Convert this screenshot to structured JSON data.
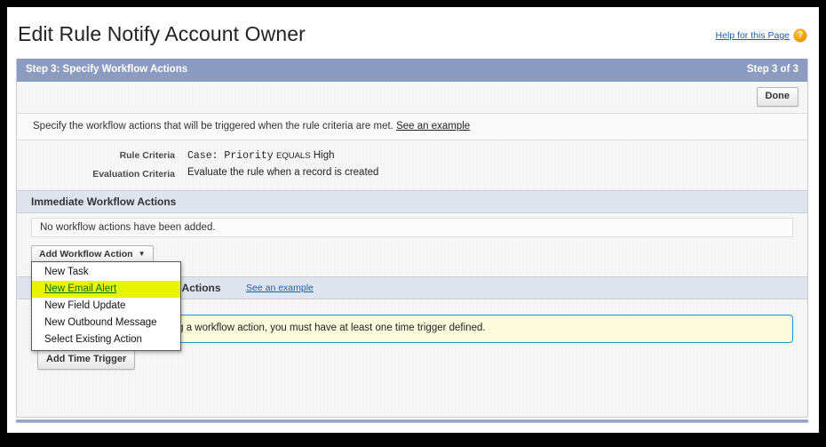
{
  "page": {
    "title": "Edit Rule Notify Account Owner",
    "help_link": "Help for this Page",
    "help_icon": "question-mark-icon",
    "help_icon_glyph": "?"
  },
  "step_bar": {
    "left_label": "Step 3: Specify Workflow Actions",
    "right_label": "Step 3 of 3",
    "background_color": "#8c9cc0"
  },
  "toolbar": {
    "done_label": "Done"
  },
  "instruction": {
    "text": "Specify the workflow actions that will be triggered when the rule criteria are met.",
    "link": "See an example"
  },
  "criteria": [
    {
      "label": "Rule Criteria",
      "object": "Case:",
      "field": "Priority",
      "operator": "EQUALS",
      "value": "High"
    },
    {
      "label": "Evaluation Criteria",
      "value": "Evaluate the rule when a record is created"
    }
  ],
  "immediate_section": {
    "title": "Immediate Workflow Actions",
    "empty_message": "No workflow actions have been added.",
    "add_button_label": "Add Workflow Action",
    "caret_glyph": "▼"
  },
  "action_menu": {
    "open": true,
    "highlight_color": "#e9f500",
    "highlight_text_color": "#0b6b22",
    "items": [
      {
        "label": "New Task",
        "highlighted": false
      },
      {
        "label": "New Email Alert",
        "highlighted": true
      },
      {
        "label": "New Field Update",
        "highlighted": false
      },
      {
        "label": "New Outbound Message",
        "highlighted": false
      },
      {
        "label": "Select Existing Action",
        "highlighted": false
      }
    ]
  },
  "time_section": {
    "title": "Time-Dependent Workflow Actions",
    "title_visible_fragment": "ow Actions",
    "link": "See an example",
    "alert_text": "No time triggers have been added. Before adding a workflow action, you must have at least one time trigger defined.",
    "alert_visible_fragment": "ave been added. Before adding a workflow action, you must have at least one time trigger defined.",
    "add_trigger_label": "Add Time Trigger"
  }
}
